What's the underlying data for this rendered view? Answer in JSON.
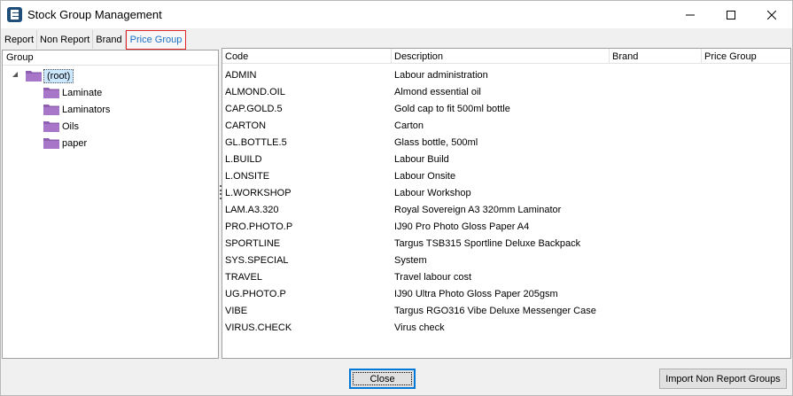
{
  "window": {
    "title": "Stock Group Management",
    "accent_color": "#0078d7",
    "active_tab_color": "#1e6fc3",
    "highlight_border_color": "#e0262a",
    "folder_color": "#8e5fb0"
  },
  "tabs": [
    {
      "label": "Report"
    },
    {
      "label": "Non Report"
    },
    {
      "label": "Brand"
    },
    {
      "label": "Price Group",
      "active": true
    }
  ],
  "group_pane": {
    "header": "Group",
    "root": {
      "label": "(root)",
      "icon": "folder-icon",
      "expanded": true
    },
    "children": [
      {
        "label": "Laminate",
        "icon": "folder-icon"
      },
      {
        "label": "Laminators",
        "icon": "folder-icon"
      },
      {
        "label": "Oils",
        "icon": "folder-icon"
      },
      {
        "label": "paper",
        "icon": "folder-icon"
      }
    ]
  },
  "grid": {
    "columns": [
      "Code",
      "Description",
      "Brand",
      "Price Group"
    ],
    "rows": [
      {
        "code": "ADMIN",
        "description": "Labour administration",
        "brand": "",
        "price_group": ""
      },
      {
        "code": "ALMOND.OIL",
        "description": "Almond essential oil",
        "brand": "",
        "price_group": ""
      },
      {
        "code": "CAP.GOLD.5",
        "description": "Gold cap to fit 500ml bottle",
        "brand": "",
        "price_group": ""
      },
      {
        "code": "CARTON",
        "description": "Carton",
        "brand": "",
        "price_group": ""
      },
      {
        "code": "GL.BOTTLE.5",
        "description": "Glass bottle, 500ml",
        "brand": "",
        "price_group": ""
      },
      {
        "code": "L.BUILD",
        "description": "Labour Build",
        "brand": "",
        "price_group": ""
      },
      {
        "code": "L.ONSITE",
        "description": "Labour Onsite",
        "brand": "",
        "price_group": ""
      },
      {
        "code": "L.WORKSHOP",
        "description": "Labour Workshop",
        "brand": "",
        "price_group": ""
      },
      {
        "code": "LAM.A3.320",
        "description": "Royal Sovereign A3 320mm Laminator",
        "brand": "",
        "price_group": ""
      },
      {
        "code": "PRO.PHOTO.P",
        "description": "IJ90 Pro Photo Gloss Paper A4",
        "brand": "",
        "price_group": ""
      },
      {
        "code": "SPORTLINE",
        "description": "Targus TSB315 Sportline Deluxe Backpack",
        "brand": "",
        "price_group": ""
      },
      {
        "code": "SYS.SPECIAL",
        "description": "System",
        "brand": "",
        "price_group": ""
      },
      {
        "code": "TRAVEL",
        "description": "Travel labour cost",
        "brand": "",
        "price_group": ""
      },
      {
        "code": "UG.PHOTO.P",
        "description": "IJ90 Ultra Photo Gloss Paper 205gsm",
        "brand": "",
        "price_group": ""
      },
      {
        "code": "VIBE",
        "description": "Targus RGO316 Vibe Deluxe Messenger Case",
        "brand": "",
        "price_group": ""
      },
      {
        "code": "VIRUS.CHECK",
        "description": "Virus check",
        "brand": "",
        "price_group": ""
      }
    ]
  },
  "buttons": {
    "close": "Close",
    "import": "Import Non Report Groups"
  }
}
